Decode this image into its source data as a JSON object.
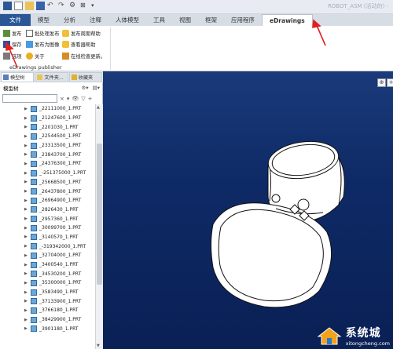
{
  "window": {
    "title": "ROBOT_ASM (活动的) -"
  },
  "tabs": [
    "文件",
    "模型",
    "分析",
    "注释",
    "人体模型",
    "工具",
    "视图",
    "框架",
    "应用程序",
    "eDrawings"
  ],
  "ribbon": {
    "publish": "发布",
    "batch_publish": "批处理发布",
    "publish_periodic": "发布周期帮助",
    "save": "保存",
    "publish_as_image": "发布为图像",
    "view_help": "查看器帮助",
    "options": "选项",
    "about": "关于",
    "check_update": "在线检查更新。",
    "group_label": "eDrawings publisher"
  },
  "panel": {
    "tabs": [
      "模型树",
      "文件夹...",
      "收藏夹"
    ],
    "title": "模型树",
    "tree_items": [
      "_22111000_1.PRT",
      "_21247600_1.PRT",
      "_2201030_1.PRT",
      "_22544500_1.PRT",
      "_23313500_1.PRT",
      "_23843700_1.PRT",
      "_24376300_1.PRT",
      "_-251375000_1.PRT",
      "_25668500_1.PRT",
      "_26437800_1.PRT",
      "_26964900_1.PRT",
      "_2826430_1.PRT",
      "_2957360_1.PRT",
      "_30099700_1.PRT",
      "_3140570_1.PRT",
      "_-319342000_1.PRT",
      "_32704000_1.PRT",
      "_3400540_1.PRT",
      "_34530200_1.PRT",
      "_35300000_1.PRT",
      "_3583490_1.PRT",
      "_37133900_1.PRT",
      "_3766180_1.PRT",
      "_38429900_1.PRT",
      "_3901180_1.PRT"
    ]
  },
  "watermark": {
    "title": "系统城",
    "url": "xitongcheng.com"
  },
  "colors": {
    "accent": "#2b5797",
    "viewport": "#0e2a66",
    "annotation": "#e02020"
  }
}
